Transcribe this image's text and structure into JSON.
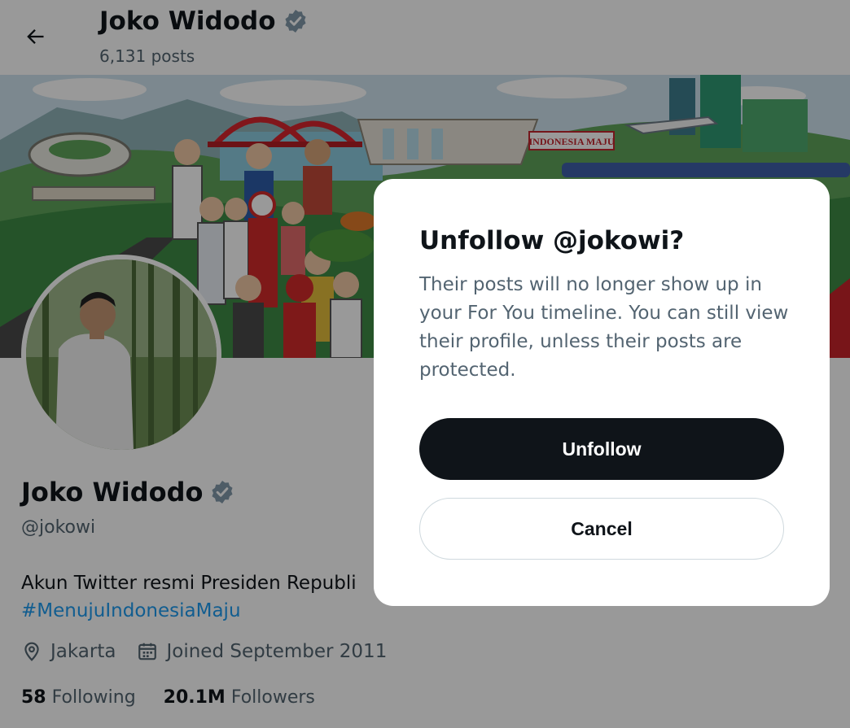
{
  "header": {
    "name": "Joko Widodo",
    "posts": "6,131 posts"
  },
  "banner": {
    "sign_text": "INDONESIA MAJU"
  },
  "profile": {
    "name": "Joko Widodo",
    "handle": "@jokowi",
    "bio_text": "Akun Twitter resmi Presiden Republi",
    "hashtag": "#MenujuIndonesiaMaju",
    "location": "Jakarta",
    "joined": "Joined September 2011",
    "following_count": "58",
    "following_label": "Following",
    "followers_count": "20.1M",
    "followers_label": "Followers"
  },
  "dialog": {
    "title": "Unfollow @jokowi?",
    "body": "Their posts will no longer show up in your For You timeline. You can still view their profile, unless their posts are protected.",
    "confirm_label": "Unfollow",
    "cancel_label": "Cancel"
  },
  "colors": {
    "accent": "#1d9bf0",
    "verified": "#829aab",
    "dark_button": "#0f1419",
    "secondary_text": "#536471"
  },
  "icons": {
    "back": "arrow-left-icon",
    "verified": "verified-badge-icon",
    "location": "location-pin-icon",
    "calendar": "calendar-icon"
  }
}
